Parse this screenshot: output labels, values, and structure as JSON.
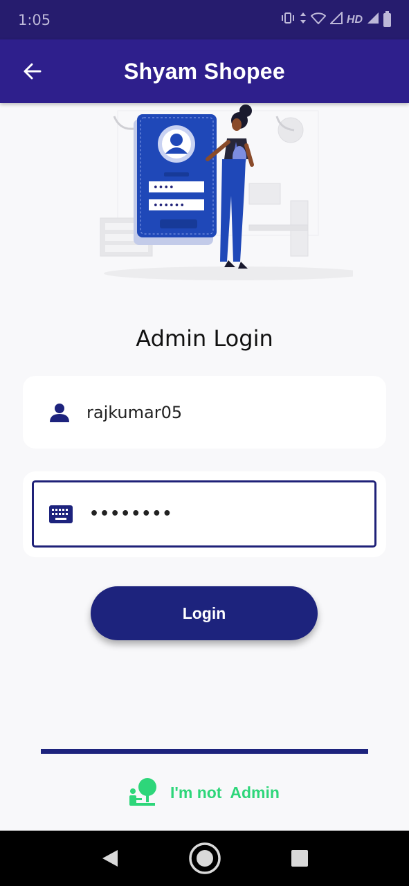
{
  "status_bar": {
    "time": "1:05",
    "network_label": "HD"
  },
  "app_bar": {
    "title": "Shyam Shopee",
    "back_icon": "arrow-left-icon"
  },
  "illustration": {
    "field_1_mask": "••••",
    "field_2_mask": "••••••"
  },
  "login": {
    "heading": "Admin Login",
    "username_value": "rajkumar05",
    "username_icon": "person-icon",
    "password_value": "••••••••",
    "password_icon": "keyboard-icon",
    "button_label": "Login"
  },
  "footer": {
    "not_admin_label": "I'm not  Admin",
    "not_admin_icon": "person-tree-icon"
  },
  "colors": {
    "status_bar": "#261c6e",
    "app_bar": "#2e1f8c",
    "primary": "#1d237d",
    "accent_green": "#2ed67a",
    "background": "#f8f8fa"
  }
}
